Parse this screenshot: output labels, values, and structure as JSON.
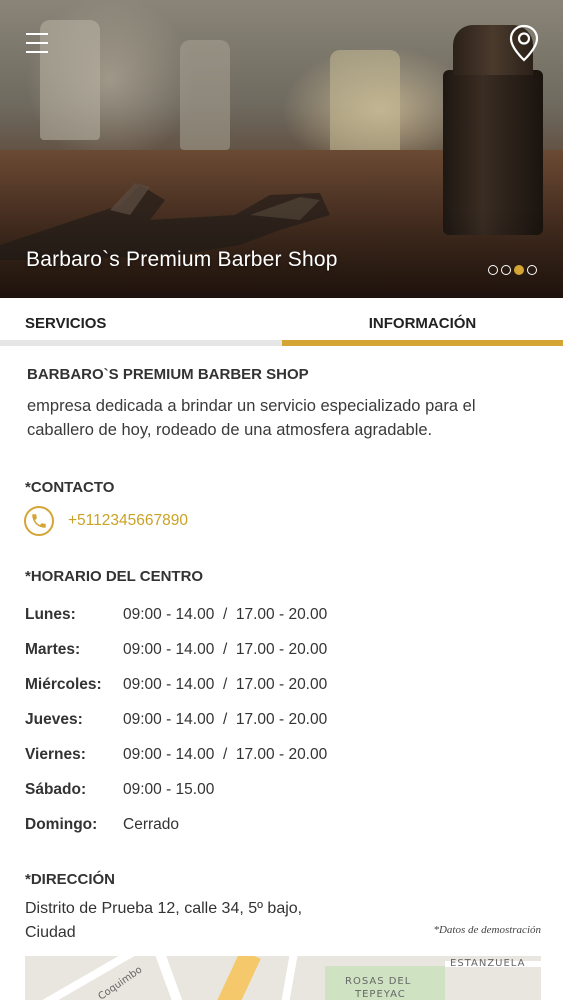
{
  "header": {
    "title": "Barbaro`s Premium Barber Shop",
    "menu_icon": "hamburger-menu-icon",
    "location_icon": "map-pin-icon",
    "slides": {
      "count": 4,
      "active_index": 2
    }
  },
  "tabs": [
    {
      "label": "SERVICIOS",
      "active": false
    },
    {
      "label": "INFORMACIÓN",
      "active": true
    }
  ],
  "colors": {
    "accent": "#d4a534",
    "phone": "#c9a227",
    "inactive_tab_bar": "#e6e6e6"
  },
  "info": {
    "business_name": "BARBARO`S PREMIUM BARBER SHOP",
    "description": "empresa dedicada a brindar un servicio especializado para el caballero de hoy, rodeado de una atmosfera agradable.",
    "contact": {
      "heading": "*CONTACTO",
      "phone": "+5112345667890",
      "icon": "phone-icon"
    },
    "hours": {
      "heading": "*HORARIO DEL CENTRO",
      "rows": [
        {
          "day": "Lunes:",
          "time": "09:00 - 14.00  /  17.00 - 20.00"
        },
        {
          "day": "Martes:",
          "time": "09:00 - 14.00  /  17.00 - 20.00"
        },
        {
          "day": "Miércoles:",
          "time": "09:00 - 14.00  /  17.00 - 20.00"
        },
        {
          "day": "Jueves:",
          "time": "09:00 - 14.00  /  17.00 - 20.00"
        },
        {
          "day": "Viernes:",
          "time": "09:00 - 14.00  /  17.00 - 20.00"
        },
        {
          "day": "Sábado:",
          "time": "09:00 - 15.00"
        },
        {
          "day": "Domingo:",
          "time": "Cerrado"
        }
      ]
    },
    "address": {
      "heading": "*DIRECCIÓN",
      "text": "Distrito de Prueba 12, calle 34, 5º bajo, Ciudad",
      "demo_note": "*Datos de demostración"
    },
    "map": {
      "labels": [
        "Coquimbo",
        "ESTANZUELA",
        "ROSAS DEL",
        "TEPEYAC"
      ]
    }
  }
}
